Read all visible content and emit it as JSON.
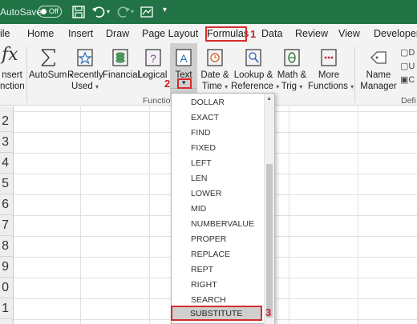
{
  "titlebar": {
    "autosave_label": "AutoSave",
    "autosave_state": "Off",
    "icons": [
      "save-icon",
      "undo-icon",
      "redo-icon",
      "form-icon",
      "customize-icon"
    ]
  },
  "tabs": [
    {
      "label": "ile"
    },
    {
      "label": "Home"
    },
    {
      "label": "Insert"
    },
    {
      "label": "Draw"
    },
    {
      "label": "Page Layout"
    },
    {
      "label": "Formulas"
    },
    {
      "label": "Data"
    },
    {
      "label": "Review"
    },
    {
      "label": "View"
    },
    {
      "label": "Developer"
    }
  ],
  "annotations": {
    "step1": "1",
    "step2": "2",
    "step3": "3"
  },
  "ribbon": {
    "insert_function": {
      "l1": "nsert",
      "l2": "nction"
    },
    "autosum": {
      "l1": "AutoSum",
      "caret": "▾"
    },
    "recently_used": {
      "l1": "Recently",
      "l2": "Used",
      "caret": "▾"
    },
    "financial": {
      "l1": "Financial",
      "caret": "▾"
    },
    "logical": {
      "l1": "Logical",
      "caret": "▾"
    },
    "text": {
      "l1": "Text"
    },
    "date_time": {
      "l1": "Date &",
      "l2": "Time",
      "caret": "▾"
    },
    "lookup_reference": {
      "l1": "Lookup &",
      "l2": "Reference",
      "caret": "▾"
    },
    "math_trig": {
      "l1": "Math &",
      "l2": "Trig",
      "caret": "▾"
    },
    "more_functions": {
      "l1": "More",
      "l2": "Functions",
      "caret": "▾"
    },
    "name_manager": {
      "l1": "Name",
      "l2": "Manager"
    },
    "group_function_library": "Functio",
    "group_defined_names": "Defi",
    "right_small": [
      "D",
      "U",
      "C"
    ]
  },
  "sheet": {
    "rows": [
      "2",
      "3",
      "4",
      "5",
      "6",
      "7",
      "8",
      "9",
      "0",
      "1"
    ]
  },
  "dropdown": {
    "items": [
      "DOLLAR",
      "EXACT",
      "FIND",
      "FIXED",
      "LEFT",
      "LEN",
      "LOWER",
      "MID",
      "NUMBERVALUE",
      "PROPER",
      "REPLACE",
      "REPT",
      "RIGHT",
      "SEARCH",
      "SUBSTITUTE"
    ],
    "selected": "SUBSTITUTE"
  },
  "colors": {
    "titlebar": "#217346",
    "highlight": "#d82b2b",
    "ribbon": "#f3f3f3"
  }
}
